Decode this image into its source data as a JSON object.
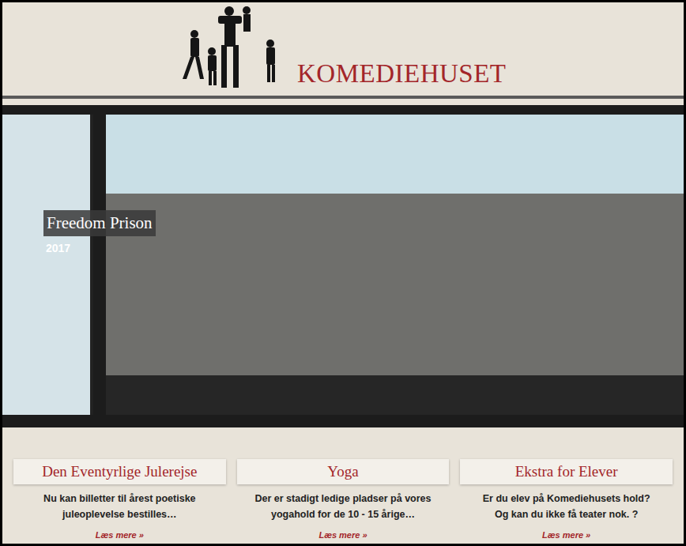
{
  "header": {
    "brand": "KOMEDIEHUSET"
  },
  "slider": {
    "caption": "Freedom Prison",
    "year": "2017"
  },
  "cards": [
    {
      "title": "Den Eventyrlige Julerejse",
      "text": "Nu kan billetter til årest poetiske juleoplevelse bestilles…",
      "link": "Læs mere »"
    },
    {
      "title": "Yoga",
      "text": "Der er stadigt ledige pladser på vores yogahold for de 10 - 15 årige…",
      "link": "Læs mere »"
    },
    {
      "title": "Ekstra for Elever",
      "text": "Er du elev på Komediehusets hold? Og kan du ikke få teater nok. ?",
      "link": "Læs mere »"
    }
  ]
}
